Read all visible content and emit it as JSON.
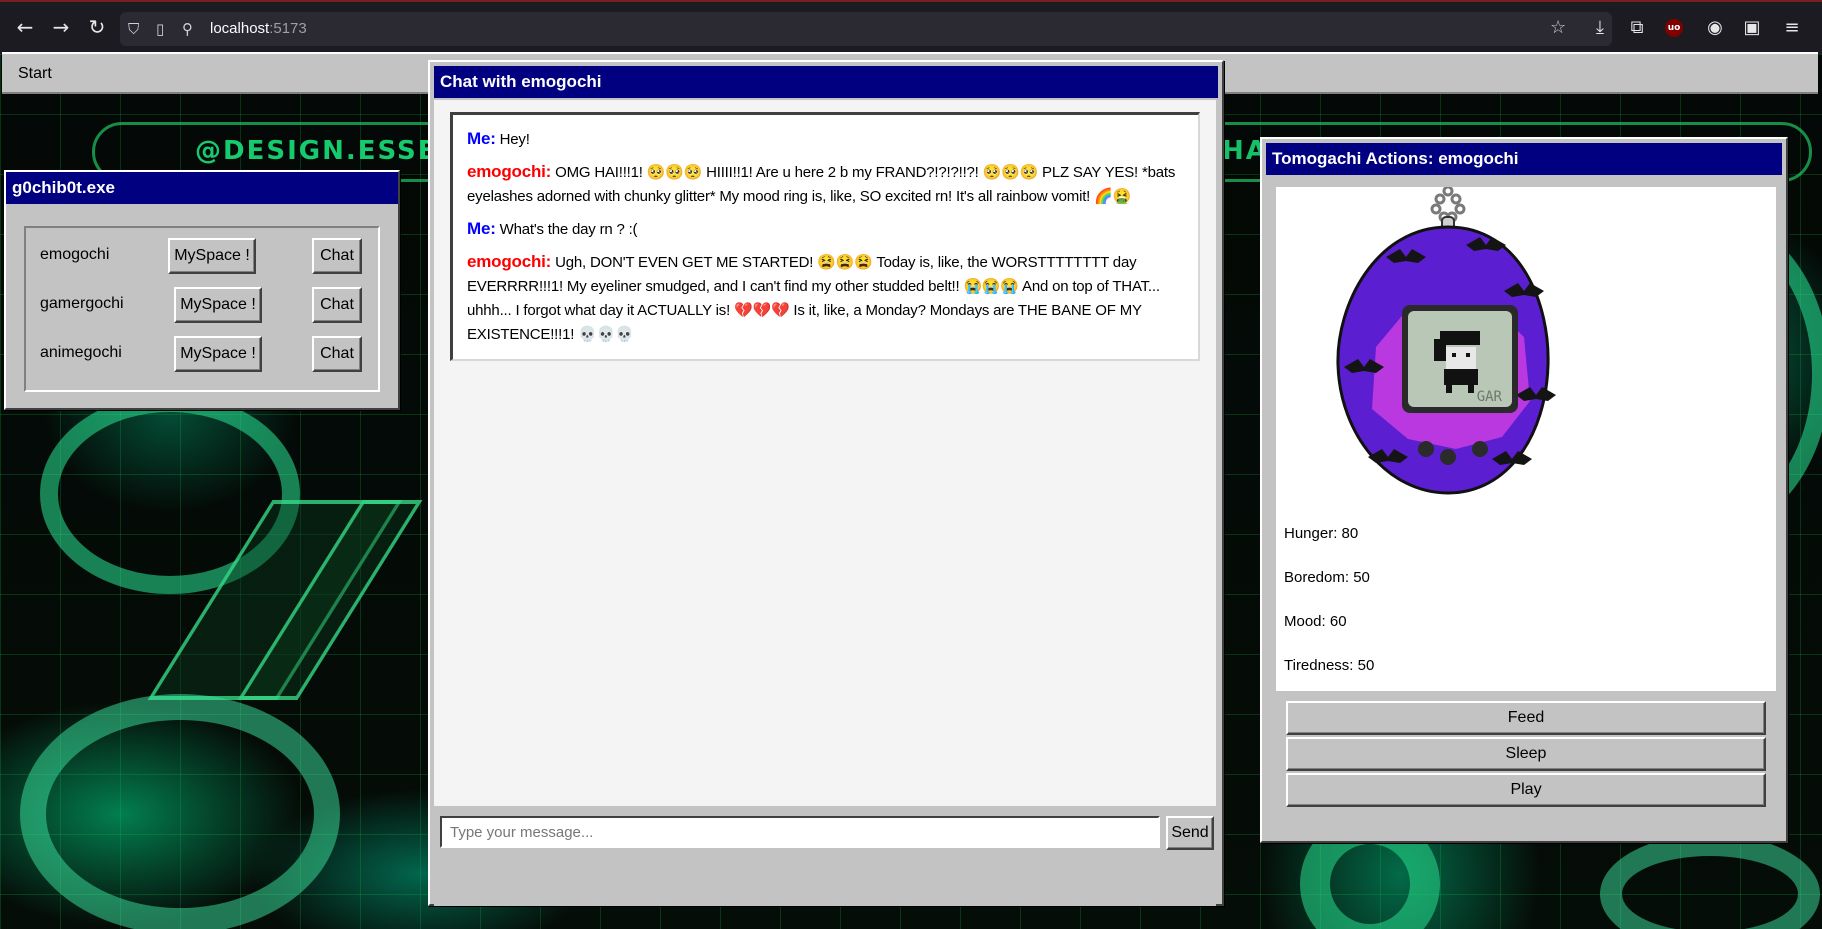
{
  "browser": {
    "url_host": "localhost",
    "url_port": ":5173"
  },
  "desktop": {
    "deco_text_left": "@DESIGN.ESSE",
    "deco_text_right": "HA"
  },
  "taskbar": {
    "start_label": "Start"
  },
  "pet_list_window": {
    "title": "g0chib0t.exe",
    "pets": [
      {
        "name": "emogochi",
        "myspace_label": "MySpace !",
        "chat_label": "Chat"
      },
      {
        "name": "gamergochi",
        "myspace_label": "MySpace !",
        "chat_label": "Chat"
      },
      {
        "name": "animegochi",
        "myspace_label": "MySpace !",
        "chat_label": "Chat"
      }
    ]
  },
  "chat_window": {
    "title": "Chat with emogochi",
    "messages": [
      {
        "sender": "Me:",
        "text": "Hey!"
      },
      {
        "sender": "emogochi:",
        "text": "OMG HAI!!!1! 🥺🥺🥺 HIIII!!1! Are u here 2 b my FRAND?!?!?!!?! 🥺🥺🥺 PLZ SAY YES! *bats eyelashes adorned with chunky glitter* My mood ring is, like, SO excited rn! It's all rainbow vomit! 🌈🤮"
      },
      {
        "sender": "Me:",
        "text": "What's the day rn ? :("
      },
      {
        "sender": "emogochi:",
        "text": "Ugh, DON'T EVEN GET ME STARTED! 😫😫😫 Today is, like, the WORSTTTTTTTT day EVERRRR!!!1! My eyeliner smudged, and I can't find my other studded belt!! 😭😭😭 And on top of THAT... uhhh... I forgot what day it ACTUALLY is! 💔💔💔 Is it, like, a Monday? Mondays are THE BANE OF MY EXISTENCE!!!1! 💀💀💀"
      }
    ],
    "input_placeholder": "Type your message...",
    "input_value": "",
    "send_label": "Send"
  },
  "actions_window": {
    "title": "Tomogachi Actions: emogochi",
    "stats": [
      {
        "label": "Hunger: 80"
      },
      {
        "label": "Boredom: 50"
      },
      {
        "label": "Mood: 60"
      },
      {
        "label": "Tiredness: 50"
      }
    ],
    "screen_brand": "GAR",
    "buttons": [
      "Feed",
      "Sleep",
      "Play"
    ],
    "colors": {
      "shell": "#5b1fd1",
      "screen": "#b9c7b6",
      "titlebar": "#000080"
    }
  }
}
